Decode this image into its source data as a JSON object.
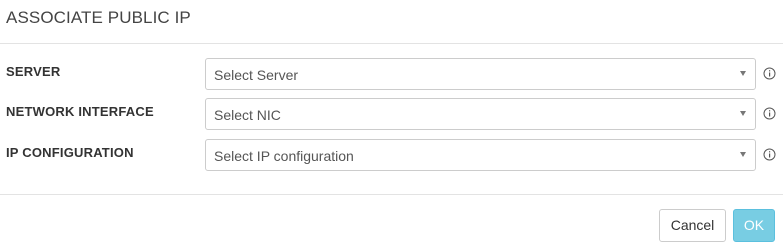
{
  "dialog": {
    "title": "ASSOCIATE PUBLIC IP"
  },
  "form": {
    "fields": [
      {
        "label": "SERVER",
        "placeholder": "Select Server",
        "info_icon": "info-circle-icon"
      },
      {
        "label": "NETWORK INTERFACE",
        "placeholder": "Select NIC",
        "info_icon": "info-circle-icon"
      },
      {
        "label": "IP CONFIGURATION",
        "placeholder": "Select IP configuration",
        "info_icon": "info-circle-icon"
      }
    ]
  },
  "footer": {
    "cancel_label": "Cancel",
    "ok_label": "OK"
  },
  "colors": {
    "primary_button": "#78cde3",
    "border": "#cccccc",
    "divider": "#e3e3e3"
  }
}
